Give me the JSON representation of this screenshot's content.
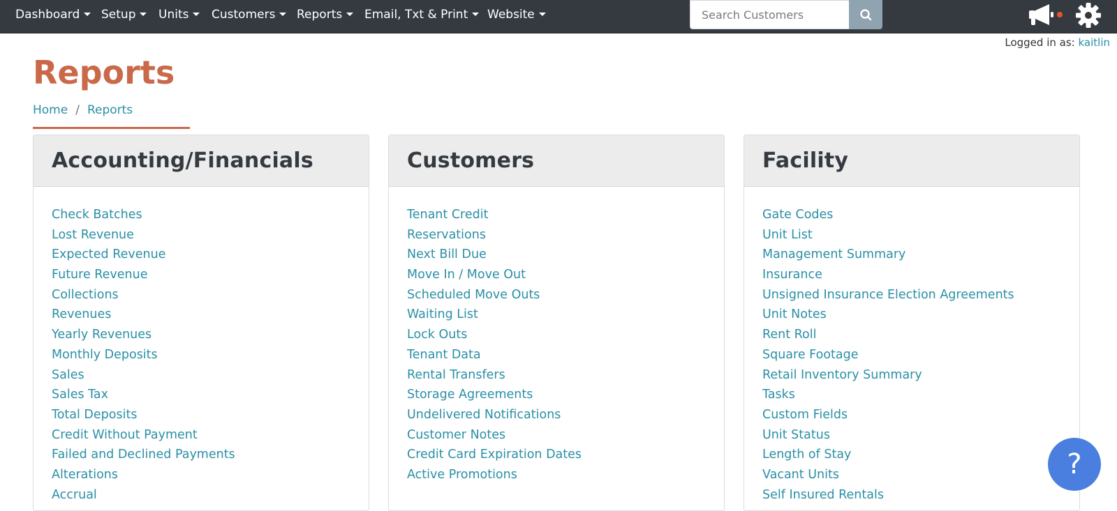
{
  "nav": {
    "items": [
      {
        "label": "Dashboard"
      },
      {
        "label": "Setup"
      },
      {
        "label": "Units"
      },
      {
        "label": "Customers"
      },
      {
        "label": "Reports"
      },
      {
        "label": "Email, Txt & Print"
      },
      {
        "label": "Website"
      }
    ],
    "search_placeholder": "Search Customers",
    "icons": {
      "search": "search-icon",
      "announcements": "megaphone-icon",
      "settings": "gear-icon"
    },
    "notification_dot_color": "#e8542a"
  },
  "user": {
    "prefix": "Logged in as:",
    "name": "kaitlin"
  },
  "page": {
    "title": "Reports"
  },
  "breadcrumb": {
    "home": "Home",
    "current": "Reports"
  },
  "cards": [
    {
      "title": "Accounting/Financials",
      "links": [
        "Check Batches",
        "Lost Revenue",
        "Expected Revenue",
        "Future Revenue",
        "Collections",
        "Revenues",
        "Yearly Revenues",
        "Monthly Deposits",
        "Sales",
        "Sales Tax",
        "Total Deposits",
        "Credit Without Payment",
        "Failed and Declined Payments",
        "Alterations",
        "Accrual"
      ]
    },
    {
      "title": "Customers",
      "links": [
        "Tenant Credit",
        "Reservations",
        "Next Bill Due",
        "Move In / Move Out",
        "Scheduled Move Outs",
        "Waiting List",
        "Lock Outs",
        "Tenant Data",
        "Rental Transfers",
        "Storage Agreements",
        "Undelivered Notifications",
        "Customer Notes",
        "Credit Card Expiration Dates",
        "Active Promotions"
      ]
    },
    {
      "title": "Facility",
      "links": [
        "Gate Codes",
        "Unit List",
        "Management Summary",
        "Insurance",
        "Unsigned Insurance Election Agreements",
        "Unit Notes",
        "Rent Roll",
        "Square Footage",
        "Retail Inventory Summary",
        "Tasks",
        "Custom Fields",
        "Unit Status",
        "Length of Stay",
        "Vacant Units",
        "Self Insured Rentals"
      ]
    }
  ],
  "help": {
    "label": "?"
  },
  "colors": {
    "accent": "#c9694a",
    "link": "#2a8fa5",
    "navbar": "#343a40",
    "help_button": "#4a7fe0"
  }
}
